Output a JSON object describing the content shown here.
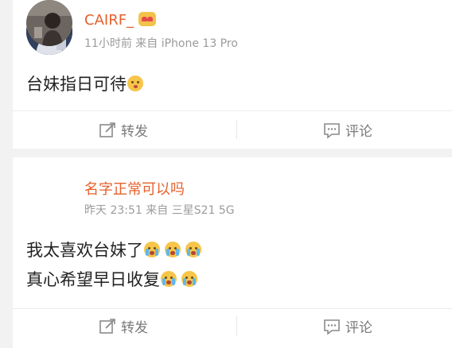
{
  "posts": [
    {
      "username": "CAIRF_",
      "meta": "11小时前 来自 iPhone 13 Pro",
      "content": [
        "台妹指日可待"
      ],
      "actions": {
        "repost": "转发",
        "comment": "评论"
      }
    },
    {
      "username": "名字正常可以吗",
      "meta": "昨天 23:51 来自 三星S21 5G",
      "content": [
        "我太喜欢台妹了",
        "真心希望早日收复"
      ],
      "actions": {
        "repost": "转发",
        "comment": "评论"
      }
    }
  ]
}
